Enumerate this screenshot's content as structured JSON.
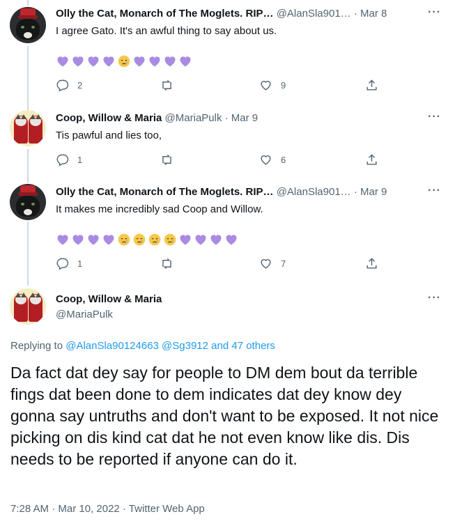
{
  "tweets": [
    {
      "name": "Olly the Cat, Monarch of The Moglets. RIP…",
      "handle": "@AlanSla901…",
      "time": "· Mar 8",
      "text": "I agree Gato.  It's an awful thing to say about us.",
      "emoji": [
        "purple-heart",
        "purple-heart",
        "purple-heart",
        "purple-heart",
        "crying-face",
        "purple-heart",
        "purple-heart",
        "purple-heart",
        "purple-heart"
      ],
      "replies": "2",
      "retweets": "",
      "likes": "9"
    },
    {
      "name": "Coop, Willow & Maria",
      "handle": "@MariaPulk",
      "time": "· Mar 9",
      "text": "Tis pawful and lies too,",
      "emoji": [],
      "replies": "1",
      "retweets": "",
      "likes": "6"
    },
    {
      "name": "Olly the Cat, Monarch of The Moglets. RIP…",
      "handle": "@AlanSla901…",
      "time": "· Mar 9",
      "text": "It makes me incredibly sad Coop and Willow.",
      "emoji": [
        "purple-heart",
        "purple-heart",
        "purple-heart",
        "purple-heart",
        "crying-face",
        "crying-face",
        "crying-face",
        "crying-face",
        "purple-heart",
        "purple-heart",
        "purple-heart",
        "purple-heart"
      ],
      "replies": "1",
      "retweets": "",
      "likes": "7"
    }
  ],
  "main_tweet": {
    "name": "Coop, Willow & Maria",
    "handle": "@MariaPulk",
    "replying_prefix": "Replying to",
    "replying_links": "@AlanSla90124663 @Sg3912 and 47 others",
    "text": "Da fact dat dey say for people to DM dem bout da terrible fings dat been done to dem indicates dat dey know dey gonna say untruths and don't want to be exposed. It not nice picking on dis kind cat dat he not even know like dis. Dis needs to be reported if anyone can do it.",
    "meta": "7:28 AM · Mar 10, 2022 · Twitter Web App"
  },
  "icons": {
    "reply": "reply-icon",
    "retweet": "retweet-icon",
    "like": "heart-outline-icon",
    "share": "share-icon",
    "more": "more-icon"
  },
  "colors": {
    "link": "#1d9bf0",
    "muted": "#536471",
    "emoji_heart": "#a98be3",
    "emoji_face": "#f6c94d"
  }
}
